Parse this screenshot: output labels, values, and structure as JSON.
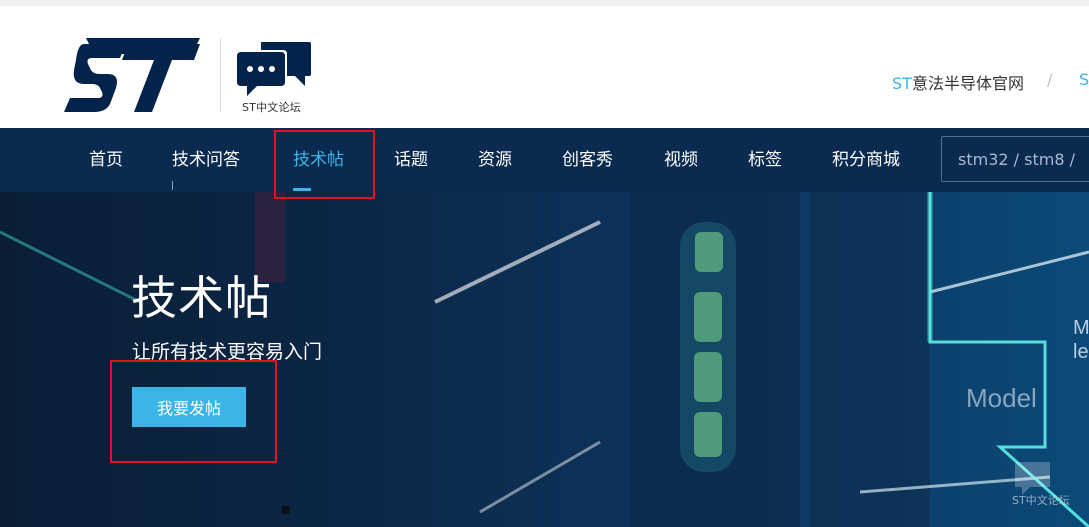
{
  "header": {
    "forum_label": "ST中文论坛",
    "official_site_prefix": "ST",
    "official_site_text": "意法半导体官网",
    "separator": "/",
    "next_link_fragment": "S"
  },
  "nav": {
    "items": [
      {
        "label": "首页"
      },
      {
        "label": "技术问答"
      },
      {
        "label": "技术帖",
        "active": true
      },
      {
        "label": "话题"
      },
      {
        "label": "资源"
      },
      {
        "label": "创客秀"
      },
      {
        "label": "视频"
      },
      {
        "label": "标签"
      },
      {
        "label": "积分商城"
      }
    ],
    "search_placeholder": "stm32 / stm8 /"
  },
  "hero": {
    "title": "技术帖",
    "subtitle": "让所有技术更容易入门",
    "post_button": "我要发帖",
    "bg_text_model": "Model",
    "bg_text_m1": "M",
    "bg_text_m2": "le",
    "watermark": "ST中文论坛"
  },
  "colors": {
    "accent": "#3cb4e6",
    "nav_bg": "#0a2a4f",
    "brand_dark": "#03234b",
    "annotation": "#e0141e"
  }
}
